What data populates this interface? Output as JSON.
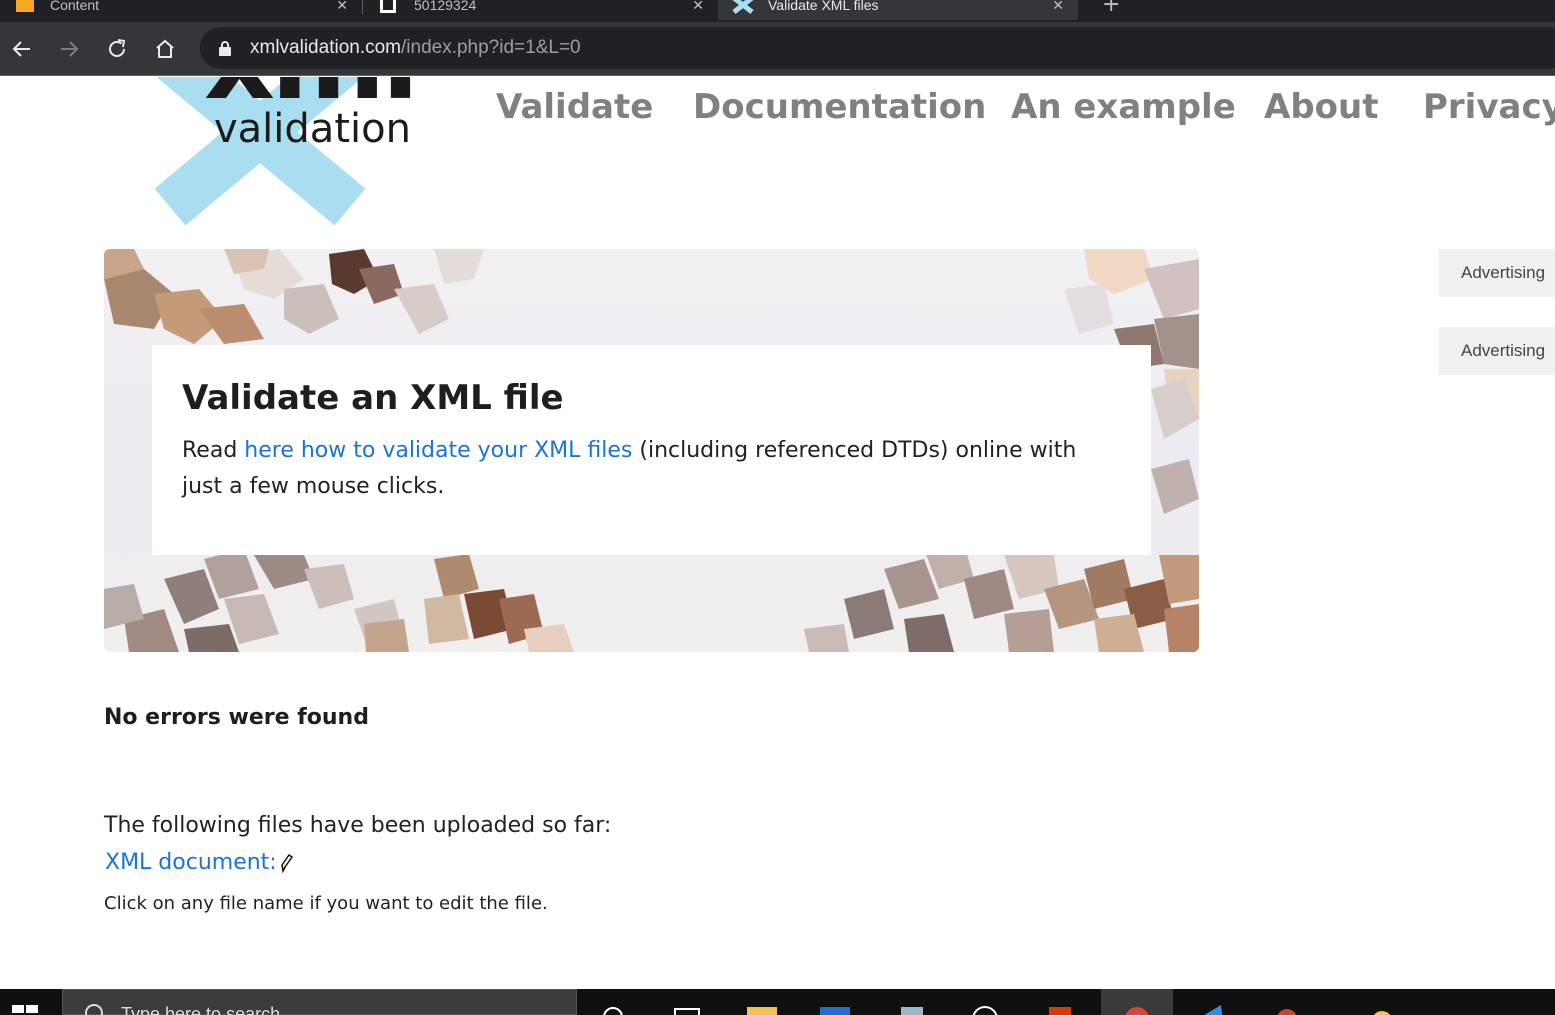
{
  "browser": {
    "tabs": [
      {
        "title": "Content",
        "active": false
      },
      {
        "title": "50129324",
        "active": false
      },
      {
        "title": "Validate XML files",
        "active": true
      }
    ],
    "url_host": "xmlvalidation.com",
    "url_path": "/index.php?id=1&L=0"
  },
  "logo": {
    "xml": "xml",
    "validation": "validation"
  },
  "nav": {
    "validate": "Validate",
    "documentation": "Documentation",
    "example": "An example",
    "about": "About",
    "privacy": "Privacy"
  },
  "hero": {
    "title": "Validate an XML file",
    "text_before": "Read ",
    "link": "here how to validate your XML files",
    "text_after": " (including referenced DTDs) online with just a few mouse clicks."
  },
  "ads": [
    "Advertising",
    "Advertising"
  ],
  "result": "No errors were found",
  "files": {
    "intro": "The following files have been uploaded so far:",
    "xml_document": "XML document:",
    "hint": "Click on any file name if you want to edit the file."
  },
  "taskbar": {
    "search_placeholder": "Type here to search"
  },
  "colors": {
    "link": "#1a73d9",
    "nav": "#808080",
    "logo_accent": "#a9ddf0",
    "chrome_dark": "#202124"
  }
}
